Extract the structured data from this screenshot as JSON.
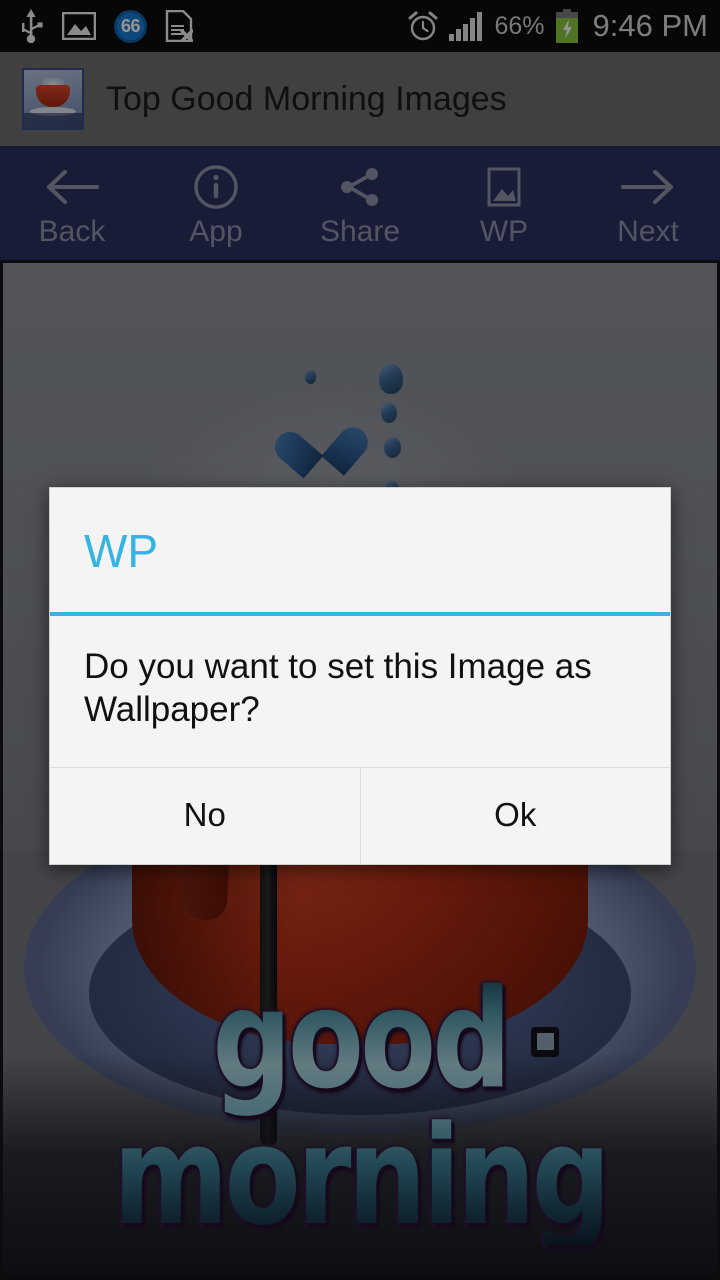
{
  "status_bar": {
    "left_icons": [
      {
        "name": "usb-icon",
        "glyph": "usb"
      },
      {
        "name": "screenshot-image-icon",
        "glyph": "image"
      },
      {
        "name": "app-badge-icon",
        "value": "66"
      },
      {
        "name": "sim-card-missing-icon",
        "glyph": "sim-x"
      }
    ],
    "alarm_icon": "alarm-clock-icon",
    "signal_icon": "signal-bars-icon",
    "battery_percent": "66%",
    "battery_icon": "battery-charging-icon",
    "time": "9:46 PM"
  },
  "title_bar": {
    "app_icon": "app-launcher-icon",
    "title": "Top Good Morning Images"
  },
  "toolbar": {
    "accent_color": "#2a3160",
    "label_color": "#8f93ab",
    "items": [
      {
        "label": "Back",
        "icon": "arrow-left-icon"
      },
      {
        "label": "App",
        "icon": "info-circle-icon"
      },
      {
        "label": "Share",
        "icon": "share-icon"
      },
      {
        "label": "WP",
        "icon": "image-frame-icon"
      },
      {
        "label": "Next",
        "icon": "arrow-right-icon"
      }
    ]
  },
  "image_view": {
    "caption_text": "good morning",
    "watermark": "square-logo-watermark"
  },
  "dialog": {
    "title": "WP",
    "accent_color": "#35b3e2",
    "message": "Do you want to set this Image as Wallpaper?",
    "buttons": [
      {
        "label": "No"
      },
      {
        "label": "Ok"
      }
    ]
  }
}
